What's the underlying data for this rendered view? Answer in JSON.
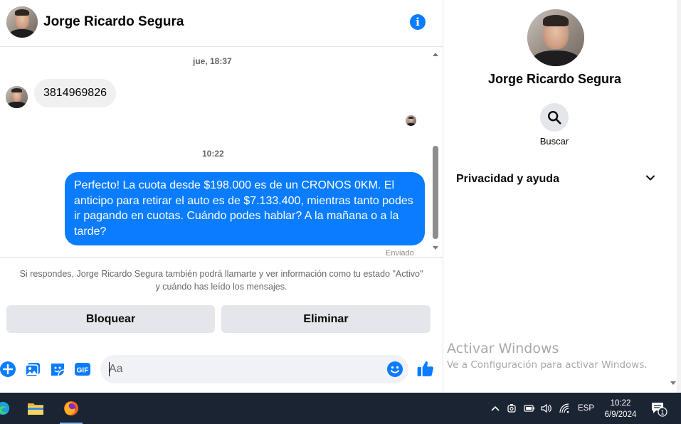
{
  "conversation": {
    "contact_name": "Jorge Ricardo Segura",
    "timestamps": [
      "jue, 18:37",
      "10:22"
    ],
    "incoming_message": "3814969826",
    "outgoing_message": "Perfecto! La cuota desde $198.000 es de un CRONOS 0KM. El anticipo para retirar el auto es de $7.133.400, mientras tanto podes ir pagando en cuotas. Cuándo podes hablar? A la mañana o a la tarde?",
    "sent_status": "Enviado"
  },
  "notice": {
    "line1": "Si respondes, Jorge Ricardo Segura también podrá llamarte y ver información como tu estado \"Activo\"",
    "line2": "y cuándo has leído los mensajes."
  },
  "actions": {
    "block_label": "Bloquear",
    "delete_label": "Eliminar"
  },
  "composer": {
    "placeholder": "Aa",
    "value": "",
    "icons": [
      "plus-icon",
      "photo-icon",
      "sticker-icon",
      "gif-icon",
      "emoji-icon",
      "like-icon"
    ],
    "gif_label": "GIF"
  },
  "details": {
    "name": "Jorge Ricardo Segura",
    "search_label": "Buscar",
    "privacy_label": "Privacidad y ayuda"
  },
  "watermark": {
    "title": "Activar Windows",
    "subtitle": "Ve a Configuración para activar Windows."
  },
  "taskbar": {
    "apps": [
      "edge-icon",
      "file-explorer-icon",
      "firefox-icon"
    ],
    "language": "ESP",
    "time": "10:22",
    "date": "6/9/2024",
    "notification_count": "1"
  },
  "colors": {
    "accent": "#0a7cff",
    "bubble_in": "#f0f0f0",
    "button_bg": "#e4e6eb",
    "taskbar_bg": "#1b2433"
  }
}
